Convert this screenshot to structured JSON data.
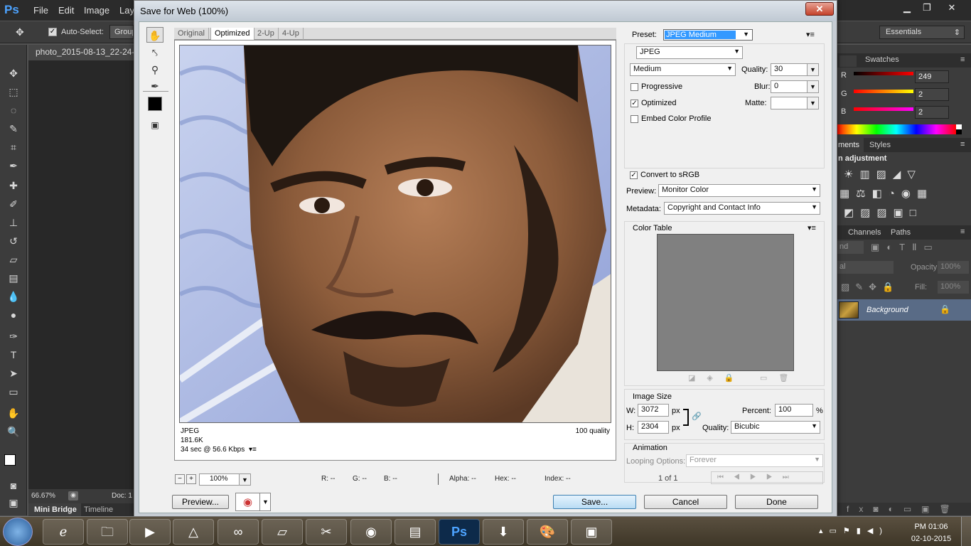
{
  "ps": {
    "logo": "Ps",
    "menus": [
      "File",
      "Edit",
      "Image",
      "Lay"
    ],
    "options": {
      "auto_select": "Auto-Select:",
      "group": "Group"
    },
    "doc_tab": "photo_2015-08-13_22-24-1",
    "doc_zoom": "66.67%",
    "doc_label": "Doc: 1",
    "bottom_tabs": [
      "Mini Bridge",
      "Timeline"
    ],
    "workspace": "Essentials",
    "panels": {
      "swatches": "Swatches",
      "rgb": [
        {
          "ch": "R",
          "val": "249"
        },
        {
          "ch": "G",
          "val": "2"
        },
        {
          "ch": "B",
          "val": "2"
        }
      ],
      "adjustments_tab": "ments",
      "styles_tab": "Styles",
      "adjustment_title": "n adjustment",
      "channels_tab": "Channels",
      "paths_tab": "Paths",
      "blend": "nd",
      "opacity": "Opacity:",
      "opacity_val": "100%",
      "lock": "al",
      "fill": "Fill:",
      "fill_val": "100%",
      "layer_name": "Background"
    }
  },
  "dialog": {
    "title": "Save for Web (100%)",
    "close": "✕",
    "tabs": [
      "Original",
      "Optimized",
      "2-Up",
      "4-Up"
    ],
    "info": {
      "format": "JPEG",
      "size": "181.6K",
      "time": "34 sec @ 56.6 Kbps",
      "quality": "100 quality"
    },
    "zoom": "100%",
    "readouts": {
      "r": "R: --",
      "g": "G: --",
      "b": "B: --",
      "alpha": "Alpha: --",
      "hex": "Hex: --",
      "index": "Index: --"
    },
    "preview_button": "Preview...",
    "save_button": "Save...",
    "cancel_button": "Cancel",
    "done_button": "Done",
    "settings": {
      "preset_label": "Preset:",
      "preset_value": "JPEG Medium",
      "format": "JPEG",
      "quality_level": "Medium",
      "quality_label": "Quality:",
      "quality_value": "30",
      "progressive": "Progressive",
      "blur_label": "Blur:",
      "blur_value": "0",
      "optimized": "Optimized",
      "matte_label": "Matte:",
      "embed_profile": "Embed Color Profile",
      "convert_srgb": "Convert to sRGB",
      "preview_label": "Preview:",
      "preview_value": "Monitor Color",
      "metadata_label": "Metadata:",
      "metadata_value": "Copyright and Contact Info",
      "color_table": "Color Table",
      "image_size": "Image Size",
      "w_label": "W:",
      "w_value": "3072",
      "h_label": "H:",
      "h_value": "2304",
      "px": "px",
      "percent_label": "Percent:",
      "percent_value": "100",
      "percent_unit": "%",
      "resample_label": "Quality:",
      "resample_value": "Bicubic",
      "animation": "Animation",
      "looping_label": "Looping Options:",
      "looping_value": "Forever",
      "frame_count": "1 of 1"
    }
  },
  "taskbar": {
    "clock_time": "PM 01:06",
    "clock_date": "02-10-2015"
  }
}
